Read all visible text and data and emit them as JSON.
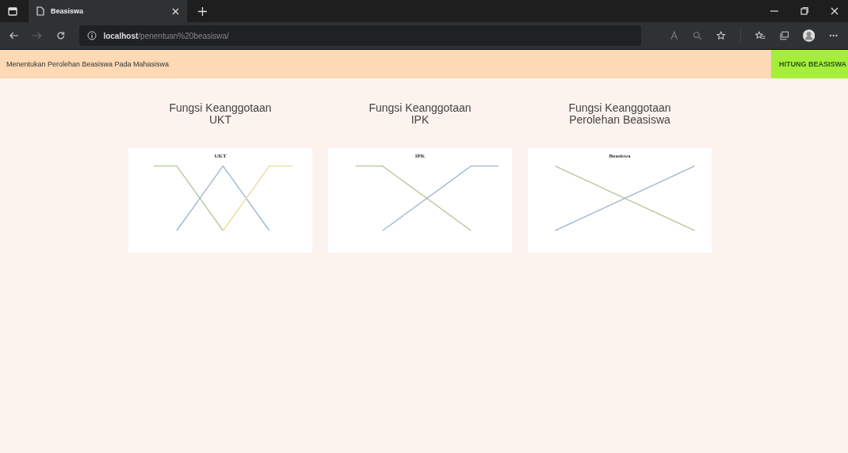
{
  "browser": {
    "tab_title": "Beasiswa",
    "url_host": "localhost",
    "url_path": "/penentuan%20beasiswa/"
  },
  "header": {
    "title": "Menentukan Perolehan Beasiswa Pada Mahasiswa",
    "button": "HITUNG BEASISWA"
  },
  "panels": [
    {
      "heading": [
        "Fungsi Keanggotaan",
        "UKT"
      ],
      "chart_title": "UKT",
      "kind": "triple"
    },
    {
      "heading": [
        "Fungsi Keanggotaan",
        "IPK"
      ],
      "chart_title": "IPK",
      "kind": "double"
    },
    {
      "heading": [
        "Fungsi Keanggotaan",
        "Perolehan Beasiswa"
      ],
      "chart_title": "Beasiswa",
      "kind": "cross"
    }
  ]
}
